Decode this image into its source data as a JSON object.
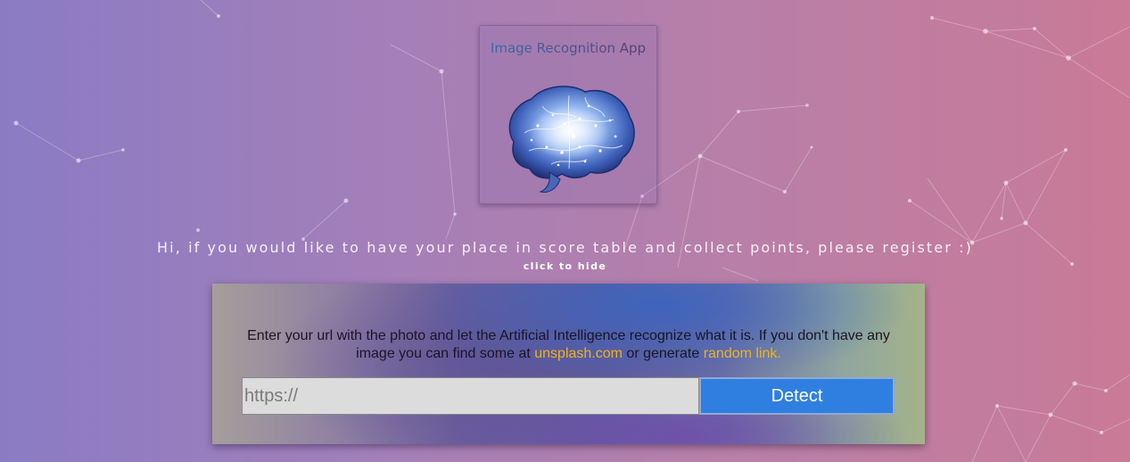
{
  "logo": {
    "title": "Image Recognition App",
    "icon": "brain-icon"
  },
  "banner": {
    "message": "Hi, if you would like to have your place in score table and collect points, please register :)",
    "hide_label": "click to hide"
  },
  "panel": {
    "text_before": "Enter your url with the photo and let the Artificial Intelligence recognize what it is. If you don't have any image you can find some at ",
    "unsplash_link": "unsplash.com",
    "text_middle": " or generate ",
    "random_link": "random link.",
    "input_placeholder": "https://",
    "input_value": "",
    "detect_label": "Detect"
  },
  "colors": {
    "accent_link": "#f2b21b",
    "detect_button": "#2f7fe0"
  }
}
